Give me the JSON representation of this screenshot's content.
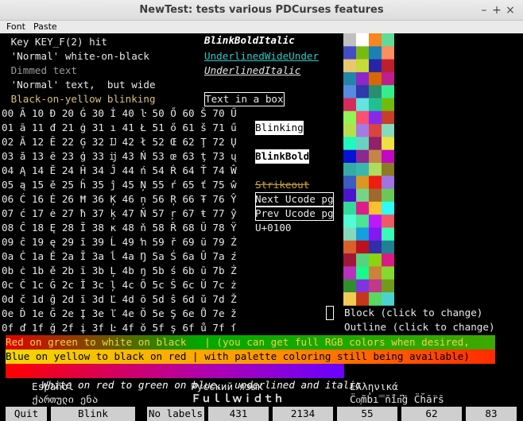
{
  "window": {
    "title": "NewTest: tests various PDCurses features",
    "controls": {
      "min": "–",
      "max": "+",
      "close": "×"
    }
  },
  "menu": [
    "Font",
    "Paste"
  ],
  "left_lines": [
    " Key KEY_F(2) hit",
    " 'Normal' white-on-black",
    " Dimmed text",
    " 'Normal' text,  but wide",
    " Black-on-yellow blinking"
  ],
  "right_labels": {
    "blink_bold_italic": "BlinkBoldItalic",
    "underlined_wide_under": "UnderlinedWideUnder",
    "underlined_italic": "UnderlinedItalic",
    "text_in_box": "Text in a box",
    "blinking": "Blinking",
    "blink_bold": "BlinkBold",
    "strikeout": "Strikeout",
    "next_ucode": "Next Ucode pg",
    "prev_ucode": "Prev Ucode pg",
    "u0100": "U+0100"
  },
  "hex_rows": [
    "00 Ā 10 Đ 20 Ġ 30 İ 40 ŀ 50 Ő 60 Š 70 Ű",
    "01 ā 11 đ 21 ġ 31 ı 41 Ł 51 ő 61 š 71 ű",
    "02 Ă 12 Ē 22 Ģ 32 Ĳ 42 ł 52 Œ 62 Ţ 72 Ų",
    "03 ă 13 ē 23 ģ 33 ĳ 43 Ń 53 œ 63 ţ 73 ų",
    "04 Ą 14 Ĕ 24 Ĥ 34 Ĵ 44 ń 54 Ŕ 64 Ť 74 Ŵ",
    "05 ą 15 ĕ 25 ĥ 35 ĵ 45 Ņ 55 ŕ 65 ť 75 ŵ",
    "06 Ć 16 Ė 26 Ħ 36 Ķ 46 ņ 56 Ŗ 66 Ŧ 76 Ŷ",
    "07 ć 17 ė 27 ħ 37 ķ 47 Ň 57 ŗ 67 ŧ 77 ŷ",
    "08 Ĉ 18 Ę 28 Ĩ 38 ĸ 48 ň 58 Ř 68 Ũ 78 Ÿ",
    "09 ĉ 19 ę 29 ĩ 39 Ĺ 49 ŉ 59 ř 69 ũ 79 Ź",
    "0a Ċ 1a Ě 2a Ī 3a ĺ 4a Ŋ 5a Ś 6a Ū 7a ź",
    "0b ċ 1b ě 2b ī 3b Ļ 4b ŋ 5b ś 6b ū 7b Ż",
    "0c Č 1c Ĝ 2c Ĭ 3c ļ 4c Ō 5c Ŝ 6c Ŭ 7c ż",
    "0d č 1d ĝ 2d ĭ 3d Ľ 4d ō 5d ŝ 6d ŭ 7d Ž",
    "0e Ď 1e Ğ 2e Į 3e ľ 4e Ŏ 5e Ş 6e Ů 7e ž",
    "0f ď 1f ğ 2f į 3f Ŀ 4f ŏ 5f ş 6f ů 7f ſ"
  ],
  "block_label": "Block (click to change)",
  "outline_label": "Outline (click to change)",
  "bars": [
    "Red on green to white on black   | (you can get full RGB colors when desired,",
    "Blue on yellow to black on red | with palette coloring still being available)",
    "White on red to green on blue,  underlined and italic"
  ],
  "lang": {
    "espanol": "Español",
    "russian": "Русский язык",
    "greek": "Ελληνικά",
    "georgian": "ქართული ენა",
    "fullwidth": "Ｆｕｌｌｗｉｄｔｈ",
    "combining": "C̈o͕m̃b̾i̿n̄i̊n͆g̈ C̈h̆ār̈s̄"
  },
  "softkeys": [
    "Quit",
    "Blink",
    "No labels",
    "431",
    "2134",
    "55",
    "62",
    "83"
  ]
}
